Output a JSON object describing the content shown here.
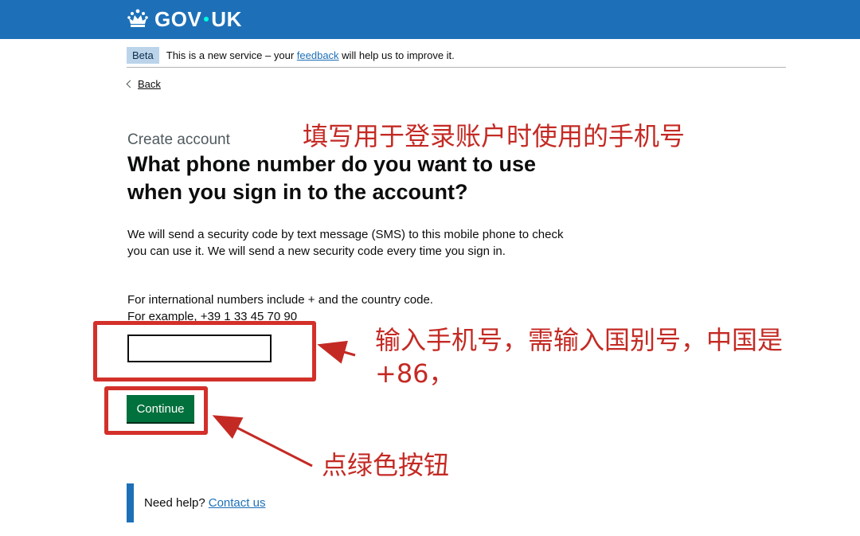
{
  "header": {
    "logo_text_left": "GOV",
    "logo_text_right": "UK",
    "logo_icon": "crown-icon",
    "colors": {
      "brand_blue": "#1d70b8",
      "button_green": "#00703c",
      "annotation_red": "#d3302a"
    }
  },
  "phase_banner": {
    "tag": "Beta",
    "text_before": "This is a new service – your",
    "link": "feedback",
    "text_after": "will help us to improve it."
  },
  "back_link": {
    "label": "Back",
    "icon": "chevron-left-icon"
  },
  "form": {
    "caption": "Create account",
    "heading": "What phone number do you want to use when you sign in to the account?",
    "description": "We will send a security code by text message (SMS) to this mobile phone to check you can use it. We will send a new security code every time you sign in.",
    "hint_line1": "For international numbers include + and the country code.",
    "hint_line2": "For example, +39 1 33 45 70 90",
    "phone_value": "",
    "continue_label": "Continue"
  },
  "help": {
    "text": "Need help?",
    "link": "Contact us"
  },
  "annotations": {
    "title_note": "填写用于登录账户时使用的手机号",
    "input_note": "输入手机号，需输入国别号，中国是+86，",
    "button_note": "点绿色按钮"
  }
}
